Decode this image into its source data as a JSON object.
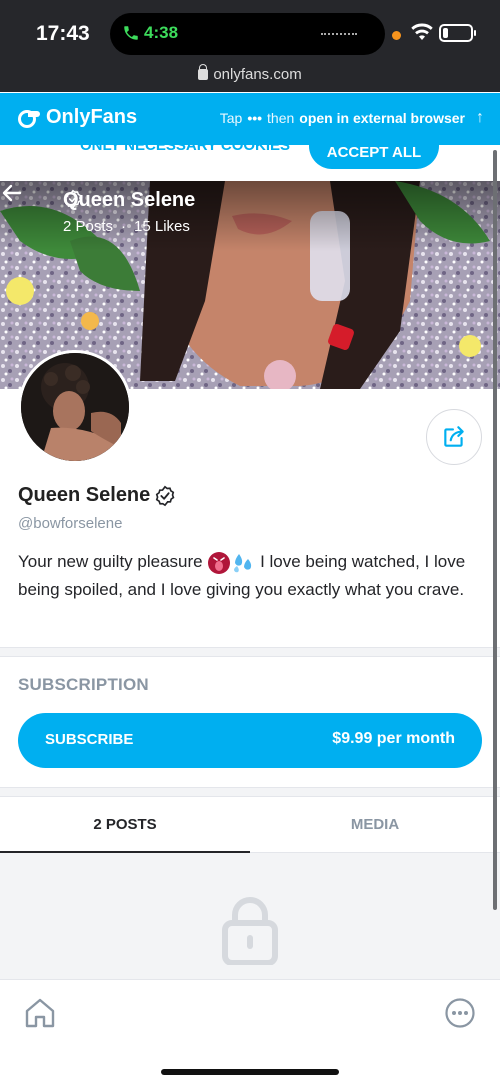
{
  "status_bar": {
    "time": "17:43",
    "call_time": "4:38",
    "url": "onlyfans.com"
  },
  "banner": {
    "brand": "OnlyFans",
    "hint_prefix": "Tap",
    "hint_dots": "•••",
    "hint_then": "then",
    "hint_action": "open in external browser",
    "hint_arrow": "↑"
  },
  "cookies": {
    "necessary_label": "ONLY NECESSARY COOKIES",
    "accept_label": "ACCEPT ALL"
  },
  "header": {
    "name": "Queen Selene",
    "posts": "2 Posts",
    "separator": "·",
    "likes": "15 Likes"
  },
  "profile": {
    "name": "Queen Selene",
    "username": "@bowforselene",
    "bio_start": "Your new guilty pleasure",
    "bio_end": "I love being watched, I love being spoiled, and I love giving you exactly what you crave.",
    "bio_emojis": [
      "tongue-emoji",
      "sweat-droplets-emoji"
    ]
  },
  "subscription": {
    "heading": "SUBSCRIPTION",
    "button_label": "SUBSCRIBE",
    "price": "$9.99 per month"
  },
  "tabs": [
    {
      "label": "2 POSTS",
      "active": true
    },
    {
      "label": "MEDIA",
      "active": false
    }
  ],
  "colors": {
    "brand": "#00aff0",
    "muted": "#8a96a3",
    "status_bar": "#26272b"
  },
  "icons": {
    "back": "arrow-left-icon",
    "verified": "verified-badge-icon",
    "share": "share-icon",
    "locked_content": "lock-icon",
    "home": "home-icon",
    "more": "more-icon"
  }
}
